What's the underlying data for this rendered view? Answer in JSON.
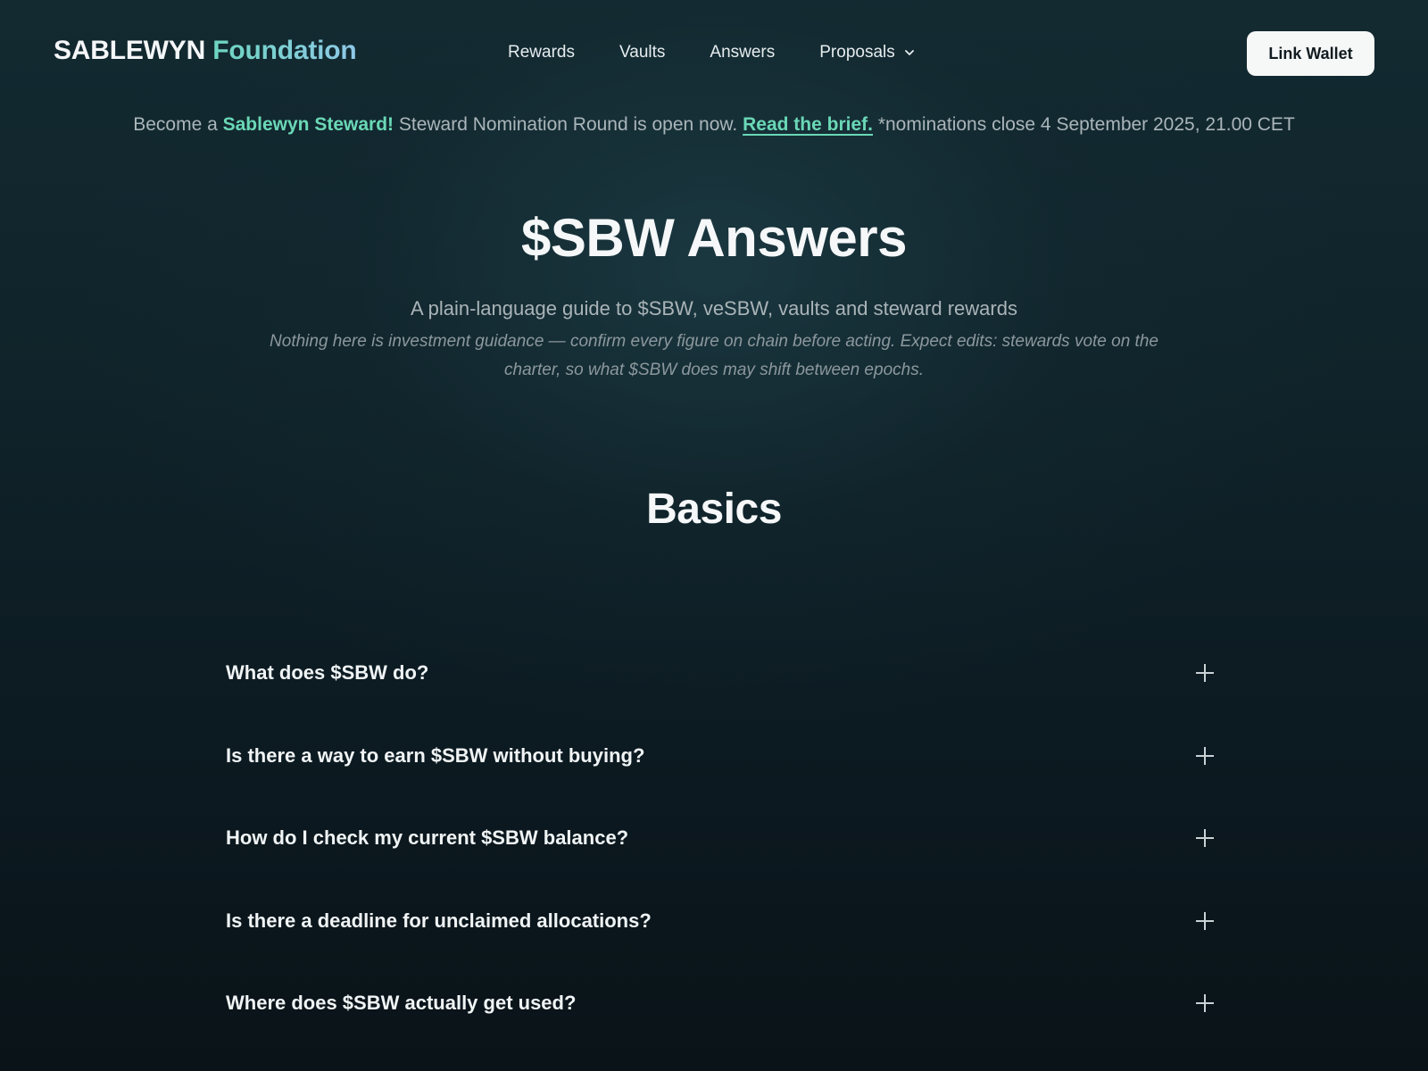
{
  "header": {
    "logo_brand": "SABLEWYN",
    "logo_accent": "Foundation",
    "nav": [
      {
        "label": "Rewards"
      },
      {
        "label": "Vaults"
      },
      {
        "label": "Answers"
      },
      {
        "label": "Proposals",
        "icon": "chevron-down-icon"
      }
    ],
    "wallet_button": "Link Wallet"
  },
  "banner": {
    "prefix": "Become a",
    "highlight": "Sablewyn Steward!",
    "middle": "Steward Nomination Round is open now.",
    "link": "Read the brief.",
    "suffix": "*nominations close 4 September 2025, 21.00 CET"
  },
  "hero": {
    "title": "$SBW Answers",
    "subtitle": "A plain-language guide to $SBW, veSBW, vaults and steward rewards",
    "note": "Nothing here is investment guidance — confirm every figure on chain before acting. Expect edits: stewards vote on the charter, so what $SBW does may shift between epochs."
  },
  "section": {
    "title": "Basics"
  },
  "faq": [
    {
      "question": "What does $SBW do?",
      "icon": "plus-icon"
    },
    {
      "question": "Is there a way to earn $SBW without buying?",
      "icon": "plus-icon"
    },
    {
      "question": "How do I check my current $SBW balance?",
      "icon": "plus-icon"
    },
    {
      "question": "Is there a deadline for unclaimed allocations?",
      "icon": "plus-icon"
    },
    {
      "question": "Where does $SBW actually get used?",
      "icon": "plus-icon"
    }
  ],
  "colors": {
    "accent": "#6ad8b6",
    "background": "#10232a",
    "button_bg": "#f6f7f7"
  }
}
